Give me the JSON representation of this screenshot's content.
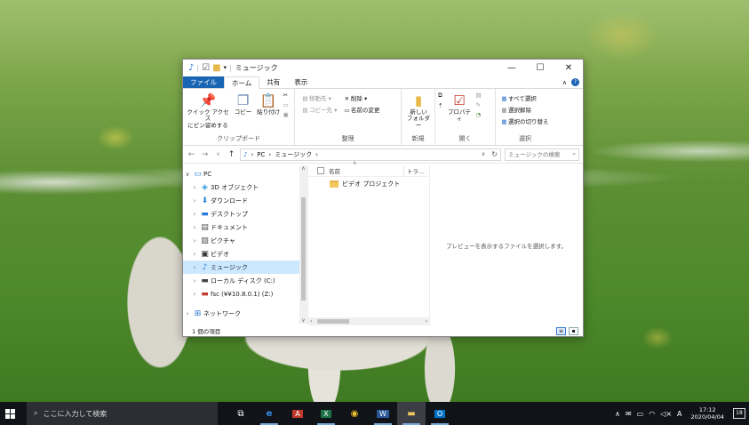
{
  "window": {
    "title": "ミュージック",
    "controls": {
      "minimize": "—",
      "maximize": "☐",
      "close": "✕"
    }
  },
  "ribbon_tabs": {
    "file": "ファイル",
    "home": "ホーム",
    "share": "共有",
    "view": "表示"
  },
  "ribbon": {
    "clipboard": {
      "label": "クリップボード",
      "pin": "クイック アクセス\nにピン留めする",
      "copy": "コピー",
      "paste": "貼り付け"
    },
    "organize": {
      "label": "整理",
      "move_to": "移動先 ▾",
      "copy_to": "コピー先 ▾",
      "delete": "削除 ▾",
      "rename": "名前の変更"
    },
    "new": {
      "label": "新規",
      "new_folder": "新しい\nフォルダー"
    },
    "open": {
      "label": "開く",
      "properties": "プロパティ"
    },
    "select": {
      "label": "選択",
      "select_all": "すべて選択",
      "select_none": "選択解除",
      "invert": "選択の切り替え"
    }
  },
  "address": {
    "pc": "PC",
    "current": "ミュージック",
    "search_placeholder": "ミュージックの検索"
  },
  "nav_tree": [
    {
      "label": "PC",
      "icon": "pc-icon"
    },
    {
      "label": "3D オブジェクト",
      "icon": "cube-icon"
    },
    {
      "label": "ダウンロード",
      "icon": "download-icon"
    },
    {
      "label": "デスクトップ",
      "icon": "desktop-icon"
    },
    {
      "label": "ドキュメント",
      "icon": "document-icon"
    },
    {
      "label": "ピクチャ",
      "icon": "picture-icon"
    },
    {
      "label": "ビデオ",
      "icon": "video-icon"
    },
    {
      "label": "ミュージック",
      "icon": "music-icon"
    },
    {
      "label": "ローカル ディスク (C:)",
      "icon": "drive-icon"
    },
    {
      "label": "fsc (¥¥10.8.0.1) (Z:)",
      "icon": "network-drive-icon"
    },
    {
      "label": "ネットワーク",
      "icon": "network-icon"
    }
  ],
  "file_list": {
    "headers": {
      "name": "名前",
      "type": "トラ..."
    },
    "items": [
      {
        "name": "ビデオ プロジェクト"
      }
    ]
  },
  "preview_text": "プレビューを表示するファイルを選択します。",
  "status": {
    "item_count": "1 個の項目"
  },
  "taskbar": {
    "search_text": "ここに入力して検索",
    "apps": [
      "task-view-icon",
      "edge-icon",
      "acrobat-icon",
      "excel-icon",
      "chrome-icon",
      "word-icon",
      "file-explorer-icon",
      "outlook-icon"
    ],
    "ime": "A",
    "time": "17:12",
    "date": "2020/04/04",
    "notifications": "18"
  },
  "colors": {
    "accent": "#1a64b4",
    "selection": "#cce8ff",
    "taskbar": "#101418"
  }
}
